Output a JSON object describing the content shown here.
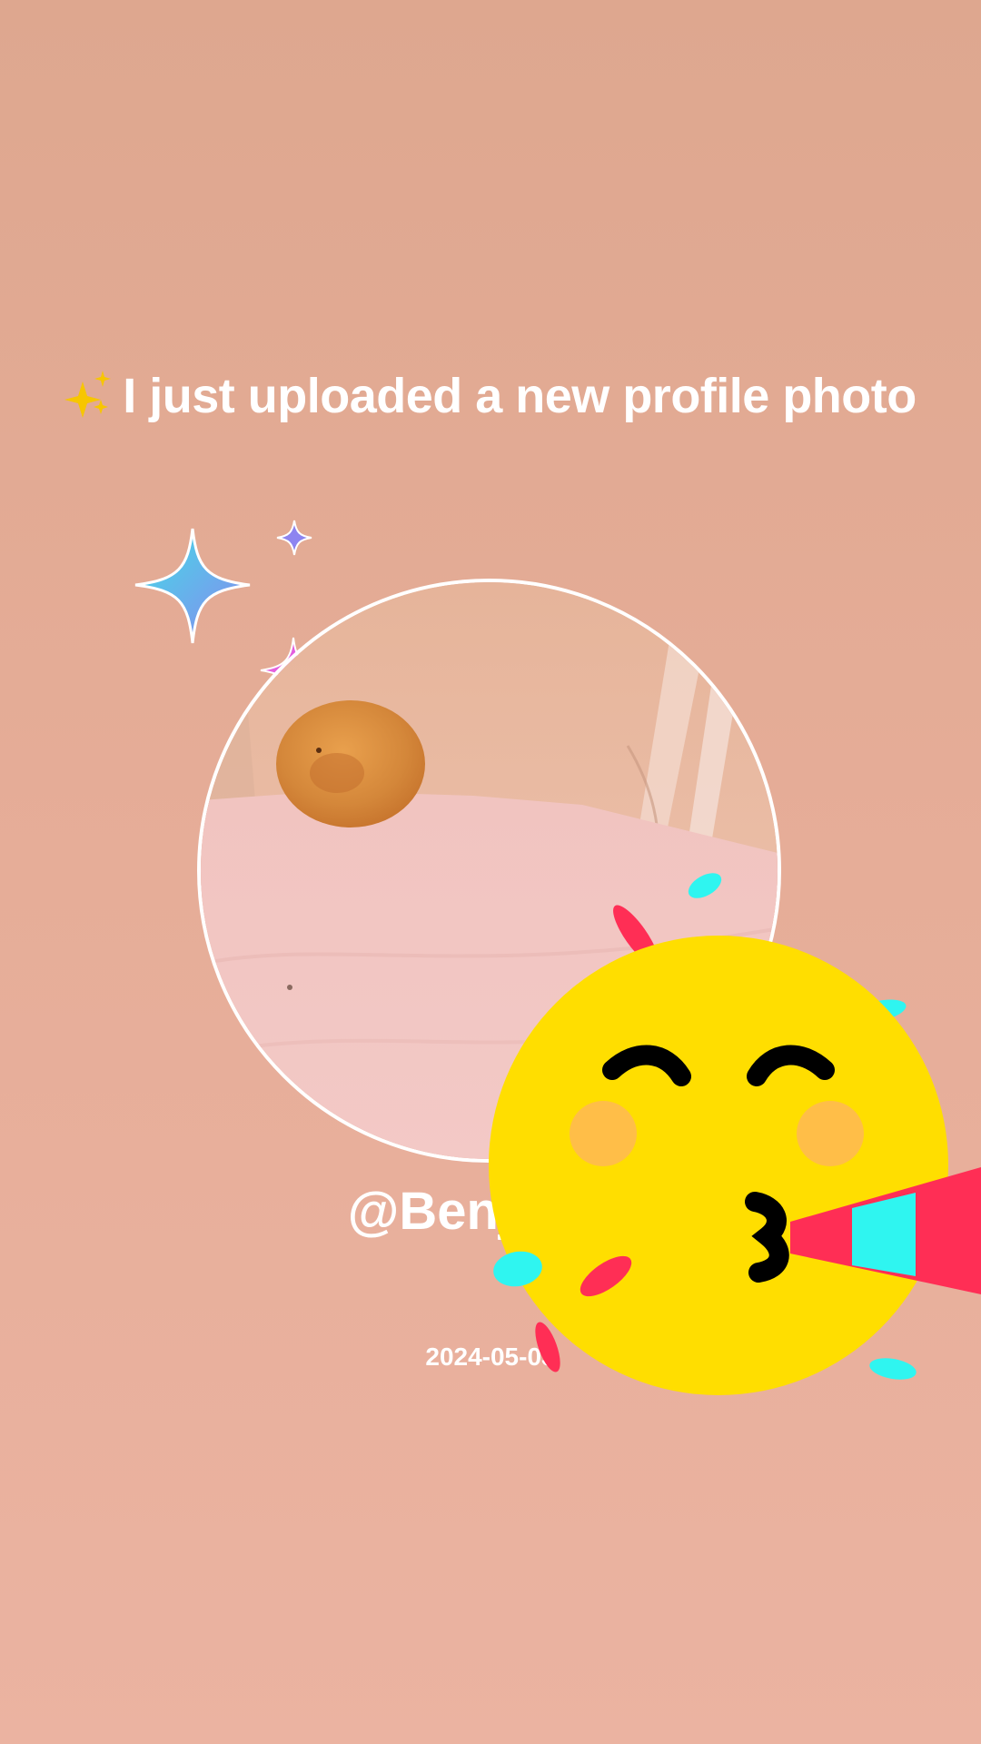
{
  "story": {
    "headline_emoji": "sparkles-icon",
    "headline": "I just uploaded a new profile photo",
    "username": "@Benjikole",
    "date": "2024-05-03"
  },
  "stickers": [
    "sparkle-large-icon",
    "sparkle-small-icon",
    "sparkle-pink-icon",
    "party-face-icon"
  ],
  "colors": {
    "background_top": "#dea78f",
    "background_bottom": "#ebb3a1",
    "text": "#ffffff",
    "face_yellow": "#ffde00",
    "confetti_red": "#ff2e55",
    "confetti_cyan": "#2ff5f0"
  }
}
